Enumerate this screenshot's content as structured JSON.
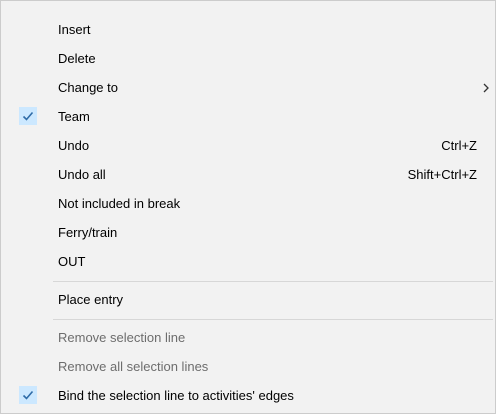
{
  "menu": {
    "items": [
      {
        "label": "Insert"
      },
      {
        "label": "Delete"
      },
      {
        "label": "Change to",
        "submenu_icon": "chevron-right-icon"
      },
      {
        "label": "Team",
        "checked": true
      },
      {
        "label": "Undo",
        "shortcut": "Ctrl+Z"
      },
      {
        "label": "Undo all",
        "shortcut": "Shift+Ctrl+Z"
      },
      {
        "label": "Not included in break"
      },
      {
        "label": "Ferry/train"
      },
      {
        "label": "OUT"
      },
      {
        "label": "Place entry"
      },
      {
        "label": "Remove selection line",
        "disabled": true
      },
      {
        "label": "Remove all selection lines",
        "disabled": true
      },
      {
        "label": "Bind the selection line to activities' edges",
        "checked": true
      }
    ]
  },
  "colors": {
    "background": "#f2f2f2",
    "check_highlight": "#cce8ff",
    "check_mark": "#2f6ca8",
    "disabled_text": "#6d6d6d"
  }
}
